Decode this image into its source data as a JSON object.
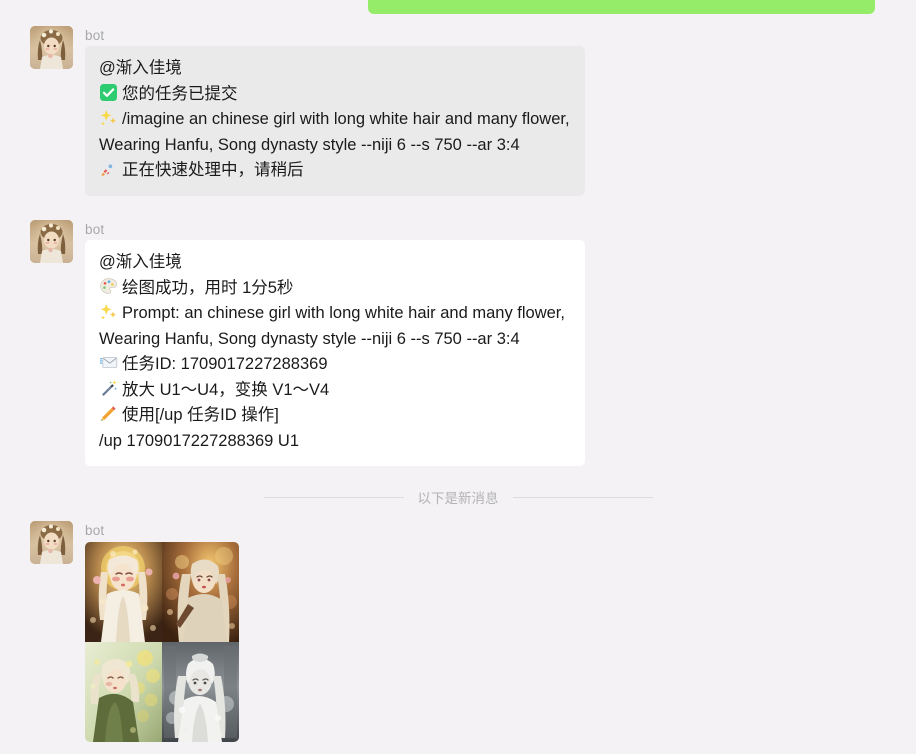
{
  "window": {
    "background_color": "#f4f2f5"
  },
  "outgoing_message": {
    "bubble_color": "#95ec69",
    "text": ""
  },
  "messages": [
    {
      "sender": "bot",
      "avatar_icon": "anime-portrait-avatar",
      "bubble_style": "gray",
      "bubble_color": "#ebeaea",
      "lines": [
        {
          "emoji": "",
          "emoji_name": "",
          "text": "@渐入佳境"
        },
        {
          "emoji": "✅",
          "emoji_name": "check-mark-button-emoji",
          "text": "您的任务已提交"
        },
        {
          "emoji": "✨",
          "emoji_name": "sparkles-emoji",
          "text": "/imagine an chinese girl with long white hair and many flower, Wearing Hanfu, Song dynasty style --niji 6 --s 750 --ar 3:4"
        },
        {
          "emoji": "🚀",
          "emoji_name": "rocket-emoji",
          "text": "正在快速处理中，请稍后"
        }
      ]
    },
    {
      "sender": "bot",
      "avatar_icon": "anime-portrait-avatar",
      "bubble_style": "white",
      "bubble_color": "#ffffff",
      "lines": [
        {
          "emoji": "",
          "emoji_name": "",
          "text": "@渐入佳境"
        },
        {
          "emoji": "🎨",
          "emoji_name": "artist-palette-emoji",
          "text": "绘图成功，用时 1分5秒"
        },
        {
          "emoji": "✨",
          "emoji_name": "sparkles-emoji",
          "text": "Prompt: an chinese girl with long white hair and many flower, Wearing Hanfu, Song dynasty style --niji 6 --s 750 --ar 3:4"
        },
        {
          "emoji": "📧",
          "emoji_name": "e-mail-emoji",
          "text": "任务ID: 1709017227288369"
        },
        {
          "emoji": "🪄",
          "emoji_name": "magic-wand-emoji",
          "text": "放大 U1～U4，变换 V1～V4"
        },
        {
          "emoji": "✏️",
          "emoji_name": "pencil-emoji",
          "text": "使用[/up 任务ID 操作]"
        },
        {
          "emoji": "",
          "emoji_name": "",
          "text": "/up 1709017227288369 U1"
        }
      ]
    }
  ],
  "divider": {
    "text": "以下是新消息",
    "line_color": "#dcdcdc",
    "text_color": "#b3b3b3"
  },
  "image_message": {
    "sender": "bot",
    "avatar_icon": "anime-portrait-avatar",
    "grid": {
      "columns": 2,
      "rows": 2,
      "cells": [
        {
          "name": "generated-image-1",
          "description": "golden-halo girl with white hair and flowers"
        },
        {
          "name": "generated-image-2",
          "description": "girl with white hair in warm amber light"
        },
        {
          "name": "generated-image-3",
          "description": "girl in green hanfu with yellow blossoms"
        },
        {
          "name": "generated-image-4",
          "description": "girl in white against monochrome garden"
        }
      ]
    }
  }
}
